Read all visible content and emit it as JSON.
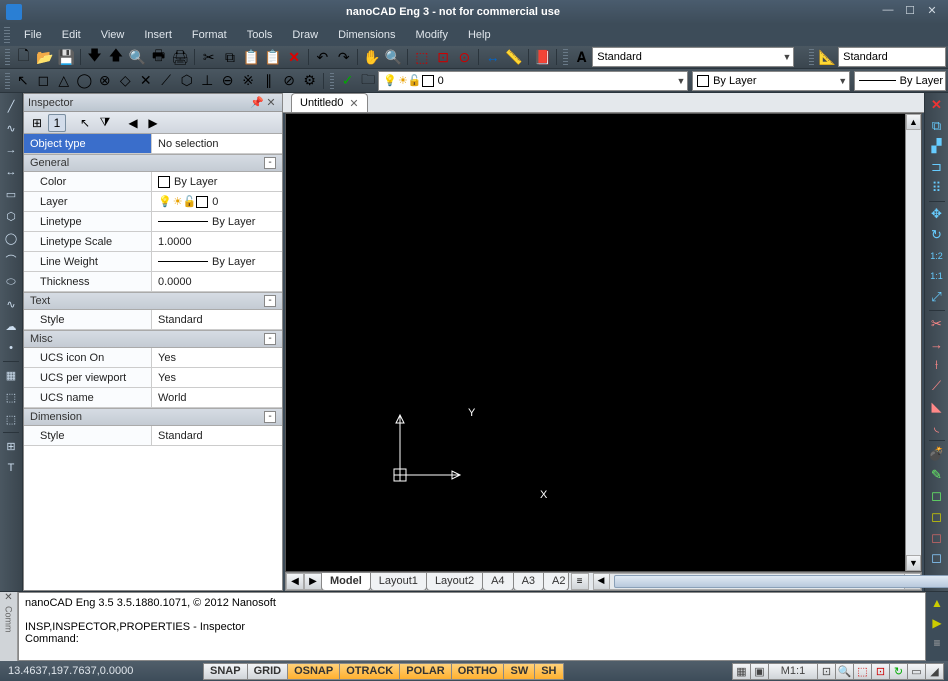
{
  "title": "nanoCAD Eng 3 - not for commercial use",
  "menu": [
    "File",
    "Edit",
    "View",
    "Insert",
    "Format",
    "Tools",
    "Draw",
    "Dimensions",
    "Modify",
    "Help"
  ],
  "textstyle_combo": "Standard",
  "dimstyle_combo": "Standard",
  "layer_combo": "0",
  "bylayer_combo1": "By Layer",
  "bylayer_combo2": "By Layer",
  "doctab": "Untitled0",
  "inspector": {
    "title": "Inspector",
    "objecttype_label": "Object type",
    "objecttype_value": "No selection",
    "groups": {
      "general": "General",
      "text": "Text",
      "misc": "Misc",
      "dimension": "Dimension"
    },
    "props": {
      "color_k": "Color",
      "color_v": "By Layer",
      "layer_k": "Layer",
      "layer_v": "0",
      "linetype_k": "Linetype",
      "linetype_v": "By Layer",
      "ltscale_k": "Linetype Scale",
      "ltscale_v": "1.0000",
      "lweight_k": "Line Weight",
      "lweight_v": "By Layer",
      "thick_k": "Thickness",
      "thick_v": "0.0000",
      "tstyle_k": "Style",
      "tstyle_v": "Standard",
      "ucsicon_k": "UCS icon On",
      "ucsicon_v": "Yes",
      "ucsvp_k": "UCS per viewport",
      "ucsvp_v": "Yes",
      "ucsname_k": "UCS name",
      "ucsname_v": "World",
      "dstyle_k": "Style",
      "dstyle_v": "Standard"
    }
  },
  "layouts": [
    "Model",
    "Layout1",
    "Layout2",
    "A4",
    "A3",
    "A2"
  ],
  "cmd": {
    "line1": "nanoCAD Eng 3.5 3.5.1880.1071, © 2012 Nanosoft",
    "line2": "INSP,INSPECTOR,PROPERTIES - Inspector",
    "prompt": "Command:"
  },
  "status": {
    "coords": "13.4637,197.7637,0.0000",
    "buttons": [
      "SNAP",
      "GRID",
      "OSNAP",
      "OTRACK",
      "POLAR",
      "ORTHO",
      "SW",
      "SH"
    ],
    "on": [
      "OSNAP",
      "OTRACK",
      "POLAR",
      "ORTHO",
      "SW",
      "SH"
    ],
    "scale": "M1:1",
    "lbl12": "1:2",
    "lbl11": "1:1"
  },
  "ucs": {
    "x": "X",
    "y": "Y"
  }
}
